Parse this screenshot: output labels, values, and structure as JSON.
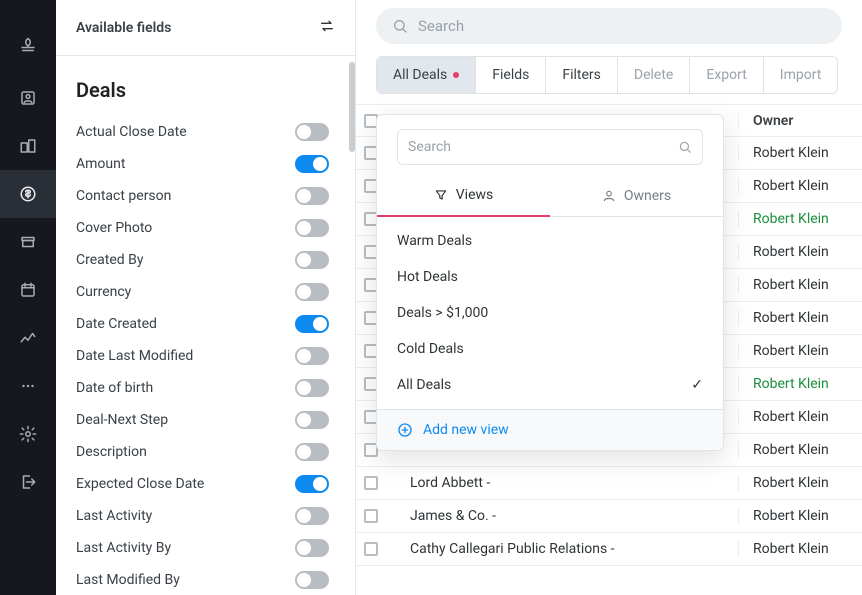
{
  "rail": {
    "items": [
      {
        "name": "logo-icon"
      },
      {
        "name": "contacts-icon"
      },
      {
        "name": "organisations-icon"
      },
      {
        "name": "deals-icon",
        "active": true
      },
      {
        "name": "archive-icon"
      },
      {
        "name": "calendar-icon"
      },
      {
        "name": "activity-icon"
      },
      {
        "name": "more-icon"
      },
      {
        "name": "settings-icon"
      },
      {
        "name": "logout-icon"
      }
    ]
  },
  "panel": {
    "title": "Available fields",
    "group": "Deals",
    "fields": [
      {
        "label": "Actual Close Date",
        "on": false
      },
      {
        "label": "Amount",
        "on": true
      },
      {
        "label": "Contact person",
        "on": false
      },
      {
        "label": "Cover Photo",
        "on": false
      },
      {
        "label": "Created By",
        "on": false
      },
      {
        "label": "Currency",
        "on": false
      },
      {
        "label": "Date Created",
        "on": true
      },
      {
        "label": "Date Last Modified",
        "on": false
      },
      {
        "label": "Date of birth",
        "on": false
      },
      {
        "label": "Deal-Next Step",
        "on": false
      },
      {
        "label": "Description",
        "on": false
      },
      {
        "label": "Expected Close Date",
        "on": true
      },
      {
        "label": "Last Activity",
        "on": false
      },
      {
        "label": "Last Activity By",
        "on": false
      },
      {
        "label": "Last Modified By",
        "on": false
      }
    ]
  },
  "search": {
    "placeholder": "Search"
  },
  "toolbar": {
    "all_deals": "All Deals",
    "fields": "Fields",
    "filters": "Filters",
    "delete": "Delete",
    "export": "Export",
    "import": "Import"
  },
  "table": {
    "header_owner": "Owner",
    "rows": [
      {
        "name": "",
        "owner": "Robert Klein",
        "link": false
      },
      {
        "name": "",
        "owner": "Robert Klein",
        "link": false
      },
      {
        "name": "",
        "owner": "Robert Klein",
        "link": true
      },
      {
        "name": "",
        "owner": "Robert Klein",
        "link": false
      },
      {
        "name": "",
        "owner": "Robert Klein",
        "link": false
      },
      {
        "name": "",
        "owner": "Robert Klein",
        "link": false
      },
      {
        "name": "",
        "owner": "Robert Klein",
        "link": false
      },
      {
        "name": "",
        "owner": "Robert Klein",
        "link": true
      },
      {
        "name": "",
        "owner": "Robert Klein",
        "link": false
      },
      {
        "name": "",
        "owner": "Robert Klein",
        "link": false
      },
      {
        "name": "Lord Abbett -",
        "owner": "Robert Klein",
        "link": false
      },
      {
        "name": "James & Co. -",
        "owner": "Robert Klein",
        "link": false
      },
      {
        "name": "Cathy Callegari Public Relations -",
        "owner": "Robert Klein",
        "link": false
      }
    ]
  },
  "dropdown": {
    "search_placeholder": "Search",
    "tab_views": "Views",
    "tab_owners": "Owners",
    "items": [
      {
        "label": "Warm Deals",
        "selected": false
      },
      {
        "label": "Hot Deals",
        "selected": false
      },
      {
        "label": "Deals > $1,000",
        "selected": false
      },
      {
        "label": "Cold Deals",
        "selected": false
      },
      {
        "label": "All Deals",
        "selected": true
      }
    ],
    "add_label": "Add new view"
  }
}
